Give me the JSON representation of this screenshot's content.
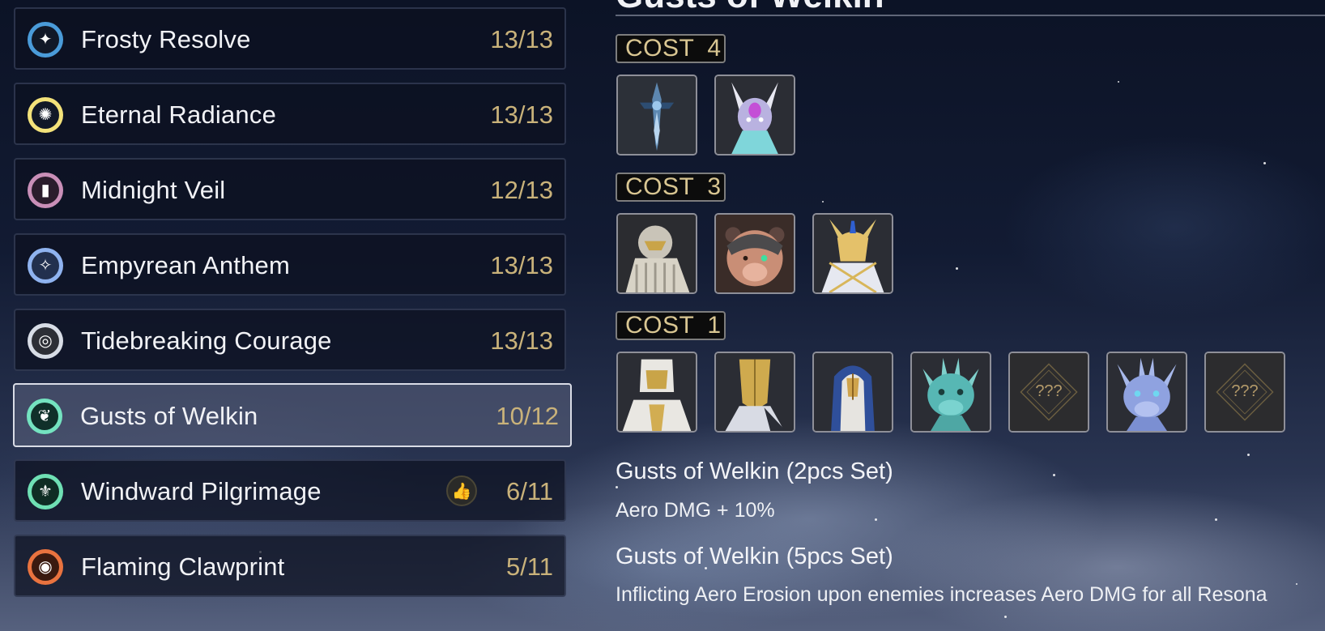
{
  "sets": [
    {
      "name": "Frosty Resolve",
      "count": "13/13",
      "icon": "snowflake-star-icon",
      "color": "#4a9bd9"
    },
    {
      "name": "Eternal Radiance",
      "count": "13/13",
      "icon": "sun-icon",
      "color": "#f3e27a"
    },
    {
      "name": "Midnight Veil",
      "count": "12/13",
      "icon": "veil-figure-icon",
      "color": "#c98fb8"
    },
    {
      "name": "Empyrean Anthem",
      "count": "13/13",
      "icon": "sparkle-icon",
      "color": "#8fb3f0"
    },
    {
      "name": "Tidebreaking Courage",
      "count": "13/13",
      "icon": "tide-circle-icon",
      "color": "#d8dde6"
    },
    {
      "name": "Gusts of Welkin",
      "count": "10/12",
      "icon": "wind-leaf-icon",
      "color": "#74e3c0",
      "selected": true
    },
    {
      "name": "Windward Pilgrimage",
      "count": "6/11",
      "icon": "fleur-icon",
      "color": "#6fe0b4",
      "recommended": true
    },
    {
      "name": "Flaming Clawprint",
      "count": "5/11",
      "icon": "flame-swirl-icon",
      "color": "#e9733f"
    }
  ],
  "detail": {
    "title": "Gusts of Welkin",
    "cost_groups": [
      {
        "label": "COST",
        "value": "4",
        "echoes": [
          {
            "kind": "sword"
          },
          {
            "kind": "dragon-violet"
          }
        ]
      },
      {
        "label": "COST",
        "value": "3",
        "echoes": [
          {
            "kind": "hooded-bird"
          },
          {
            "kind": "bear"
          },
          {
            "kind": "golden-knight"
          }
        ]
      },
      {
        "label": "COST",
        "value": "1",
        "echoes": [
          {
            "kind": "white-knight"
          },
          {
            "kind": "gold-mask"
          },
          {
            "kind": "blue-hood"
          },
          {
            "kind": "teal-dragon"
          },
          {
            "kind": "unknown",
            "label": "???"
          },
          {
            "kind": "blue-dragon"
          },
          {
            "kind": "unknown",
            "label": "???"
          }
        ]
      }
    ],
    "effects": [
      {
        "title": "Gusts of Welkin (2pcs Set)",
        "text": "Aero DMG + 10%"
      },
      {
        "title": "Gusts of Welkin (5pcs Set)",
        "text": "Inflicting Aero Erosion upon enemies increases Aero DMG for all Resona"
      }
    ]
  },
  "colors": {
    "count_gold": "#c9b27a",
    "cost_gold": "#d9c692",
    "unknown_gold": "#b39a6a"
  }
}
